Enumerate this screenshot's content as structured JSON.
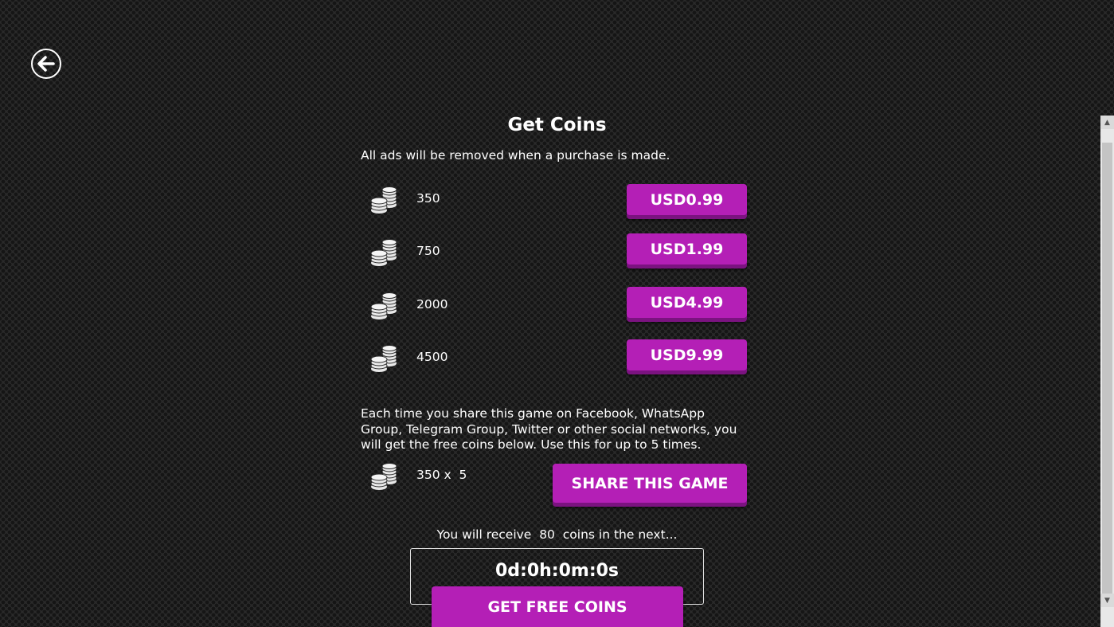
{
  "header": {
    "back_icon": "back-arrow-icon",
    "title": "Get Coins"
  },
  "purchase": {
    "note": "All ads will be removed when a purchase is made.",
    "coin_icon": "coin-stack-icon",
    "packs": [
      {
        "amount": "350",
        "price": "USD0.99"
      },
      {
        "amount": "750",
        "price": "USD1.99"
      },
      {
        "amount": "2000",
        "price": "USD4.99"
      },
      {
        "amount": "4500",
        "price": "USD9.99"
      }
    ]
  },
  "share": {
    "text": "Each time you share this game on Facebook, WhatsApp Group, Telegram Group, Twitter or other social networks, you will get the free coins below. Use this for up to 5 times.",
    "reward": "350 x  5",
    "button_label": "SHARE THIS GAME"
  },
  "free_coins": {
    "receive_text": "You will receive  80  coins in the next...",
    "timer": "0d:0h:0m:0s",
    "button_label": "GET FREE COINS"
  },
  "colors": {
    "button": "#b41fb6",
    "button_shadow": "#7b1380",
    "background": "#2a2a2a"
  }
}
